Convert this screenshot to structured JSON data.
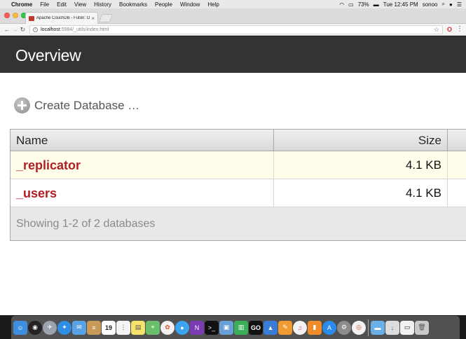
{
  "menubar": {
    "app_name": "Chrome",
    "items": [
      "File",
      "Edit",
      "View",
      "History",
      "Bookmarks",
      "People",
      "Window",
      "Help"
    ],
    "battery": "73%",
    "clock": "Tue 12:45 PM",
    "user": "sonoo"
  },
  "browser": {
    "tab_title": "Apache CouchDB - Futon: Ov",
    "url_host": "localhost",
    "url_path": ":5984/_utils/index.html"
  },
  "page": {
    "title": "Overview",
    "create_db_label": "Create Database …",
    "table": {
      "headers": {
        "name": "Name",
        "size": "Size"
      },
      "rows": [
        {
          "name": "_replicator",
          "size": "4.1 KB"
        },
        {
          "name": "_users",
          "size": "4.1 KB"
        }
      ],
      "footer": "Showing 1-2 of 2 databases"
    }
  },
  "colors": {
    "header_bg": "#333333",
    "db_name": "#b21e24",
    "row_highlight": "#fffeea"
  },
  "dock": {
    "icons": [
      "finder-icon",
      "siri-icon",
      "launchpad-icon",
      "safari-icon",
      "mail-icon",
      "notes-icon",
      "calendar-icon",
      "reminders-icon",
      "stickies-icon",
      "maps-icon",
      "photos-icon",
      "messages-icon",
      "onenote-icon",
      "terminal-icon",
      "preview-icon",
      "numbers-icon",
      "goland-icon",
      "keynote-icon",
      "pages-icon",
      "itunes-icon",
      "ibooks-icon",
      "app-store-icon",
      "system-preferences-icon",
      "chrome-icon",
      "folder-icon",
      "downloads-icon",
      "screen-icon",
      "trash-icon"
    ],
    "calendar_day": "19"
  }
}
